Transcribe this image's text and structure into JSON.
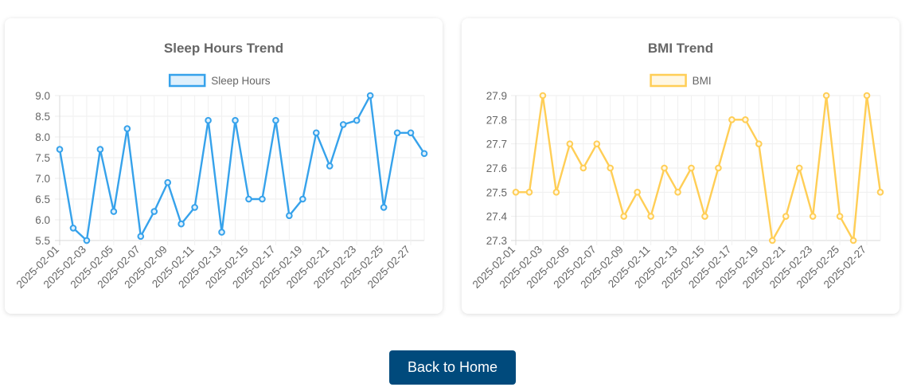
{
  "chart_data": [
    {
      "type": "line",
      "title": "Sleep Hours Trend",
      "x": [
        "2025-02-01",
        "2025-02-02",
        "2025-02-03",
        "2025-02-04",
        "2025-02-05",
        "2025-02-06",
        "2025-02-07",
        "2025-02-08",
        "2025-02-09",
        "2025-02-10",
        "2025-02-11",
        "2025-02-12",
        "2025-02-13",
        "2025-02-14",
        "2025-02-15",
        "2025-02-16",
        "2025-02-17",
        "2025-02-18",
        "2025-02-19",
        "2025-02-20",
        "2025-02-21",
        "2025-02-22",
        "2025-02-23",
        "2025-02-24",
        "2025-02-25",
        "2025-02-26",
        "2025-02-27",
        "2025-02-28"
      ],
      "x_tick_labels": [
        "2025-02-01",
        "2025-02-03",
        "2025-02-05",
        "2025-02-07",
        "2025-02-09",
        "2025-02-11",
        "2025-02-13",
        "2025-02-15",
        "2025-02-17",
        "2025-02-19",
        "2025-02-21",
        "2025-02-23",
        "2025-02-25",
        "2025-02-27"
      ],
      "y_ticks": [
        "5.5",
        "6.0",
        "6.5",
        "7.0",
        "7.5",
        "8.0",
        "8.5",
        "9.0"
      ],
      "ylim": [
        5.5,
        9.0
      ],
      "grid": true,
      "legend_position": "top",
      "series": [
        {
          "name": "Sleep Hours",
          "color": "#36a2eb",
          "fill": "#dff0fc",
          "values": [
            7.7,
            5.8,
            5.5,
            7.7,
            6.2,
            8.2,
            5.6,
            6.2,
            6.9,
            5.9,
            6.3,
            8.4,
            5.7,
            8.4,
            6.5,
            6.5,
            8.4,
            6.1,
            6.5,
            8.1,
            7.3,
            8.3,
            8.4,
            9.0,
            6.3,
            8.1,
            8.1,
            7.6
          ]
        }
      ]
    },
    {
      "type": "line",
      "title": "BMI Trend",
      "x": [
        "2025-02-01",
        "2025-02-02",
        "2025-02-03",
        "2025-02-04",
        "2025-02-05",
        "2025-02-06",
        "2025-02-07",
        "2025-02-08",
        "2025-02-09",
        "2025-02-10",
        "2025-02-11",
        "2025-02-12",
        "2025-02-13",
        "2025-02-14",
        "2025-02-15",
        "2025-02-16",
        "2025-02-17",
        "2025-02-18",
        "2025-02-19",
        "2025-02-20",
        "2025-02-21",
        "2025-02-22",
        "2025-02-23",
        "2025-02-24",
        "2025-02-25",
        "2025-02-26",
        "2025-02-27",
        "2025-02-28"
      ],
      "x_tick_labels": [
        "2025-02-01",
        "2025-02-03",
        "2025-02-05",
        "2025-02-07",
        "2025-02-09",
        "2025-02-11",
        "2025-02-13",
        "2025-02-15",
        "2025-02-17",
        "2025-02-19",
        "2025-02-21",
        "2025-02-23",
        "2025-02-25",
        "2025-02-27"
      ],
      "y_ticks": [
        "27.3",
        "27.4",
        "27.5",
        "27.6",
        "27.7",
        "27.8",
        "27.9"
      ],
      "ylim": [
        27.3,
        27.9
      ],
      "grid": true,
      "legend_position": "top",
      "series": [
        {
          "name": "BMI",
          "color": "#ffce56",
          "fill": "#fff7e3",
          "values": [
            27.5,
            27.5,
            27.9,
            27.5,
            27.7,
            27.6,
            27.7,
            27.6,
            27.4,
            27.5,
            27.4,
            27.6,
            27.5,
            27.6,
            27.4,
            27.6,
            27.8,
            27.8,
            27.7,
            27.3,
            27.4,
            27.6,
            27.4,
            27.9,
            27.4,
            27.3,
            27.9,
            27.5
          ]
        }
      ]
    }
  ],
  "nav": {
    "back_home_label": "Back to Home",
    "button_color": "#004a7c"
  }
}
